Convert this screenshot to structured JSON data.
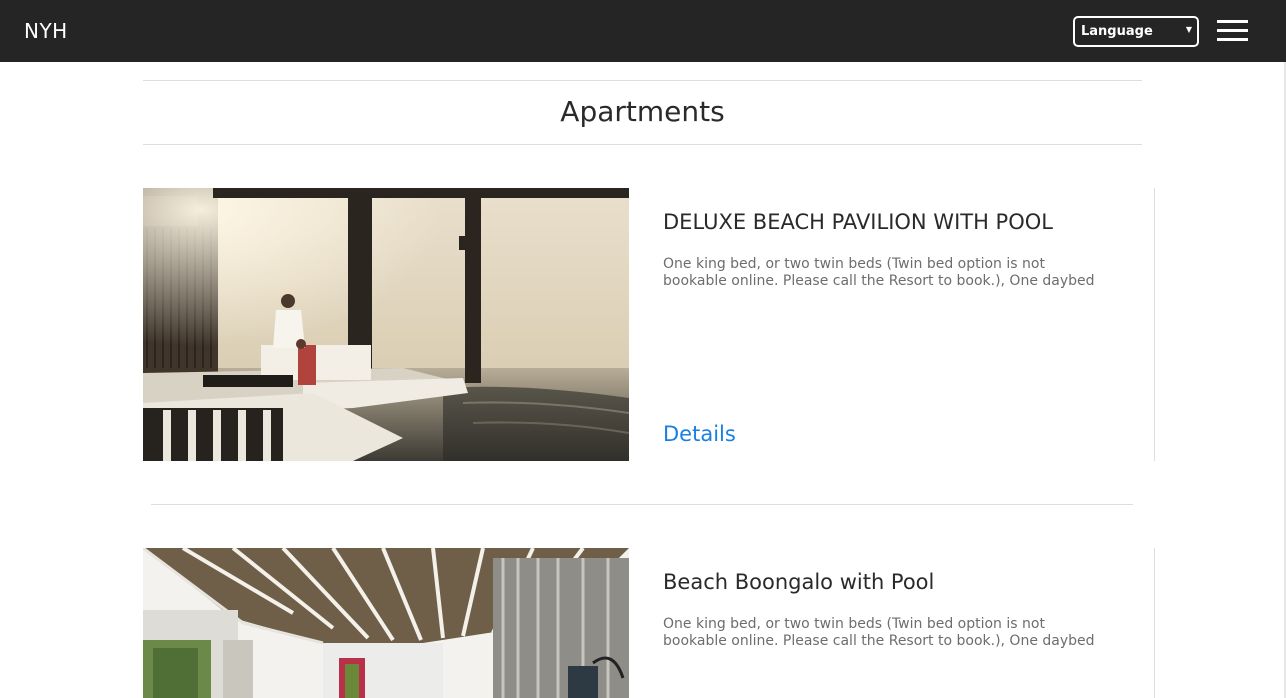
{
  "header": {
    "brand": "NYH",
    "language_select": {
      "selected": "Language"
    }
  },
  "main": {
    "title": "Apartments",
    "apartments": [
      {
        "title": "DELUXE BEACH PAVILION WITH POOL",
        "description": "One king bed, or two twin beds (Twin bed option is not bookable online. Please call the Resort to book.), One daybed",
        "link_label": "Details"
      },
      {
        "title": "Beach Boongalo with Pool",
        "description": "One king bed, or two twin beds (Twin bed option is not bookable online. Please call the Resort to book.), One daybed"
      }
    ]
  }
}
